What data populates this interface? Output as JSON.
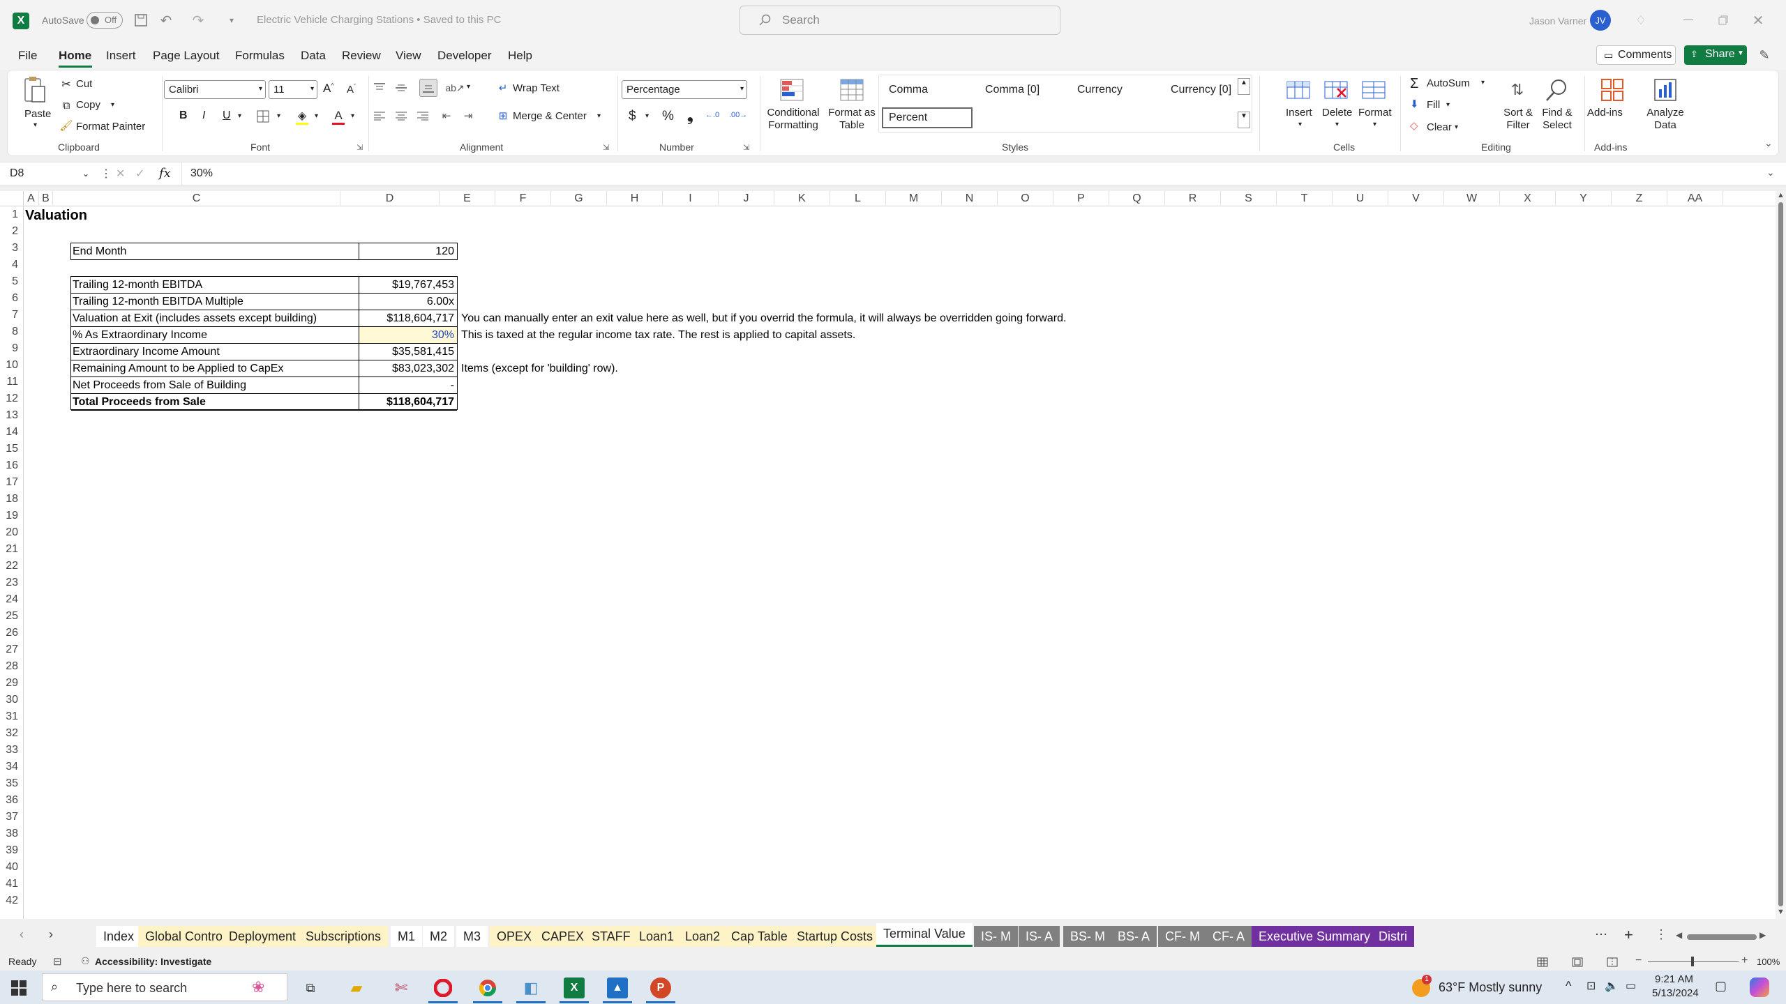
{
  "app": {
    "autosave_label": "AutoSave",
    "autosave_state": "Off",
    "doc_title": "Electric Vehicle Charging Stations • Saved to this PC",
    "search_placeholder": "Search",
    "user_name": "Jason Varner",
    "user_initials": "JV"
  },
  "menu": [
    "File",
    "Home",
    "Insert",
    "Page Layout",
    "Formulas",
    "Data",
    "Review",
    "View",
    "Developer",
    "Help"
  ],
  "menu_active": "Home",
  "comments_label": "Comments",
  "share_label": "Share",
  "ribbon": {
    "clipboard": {
      "paste": "Paste",
      "cut": "Cut",
      "copy": "Copy",
      "format_painter": "Format Painter",
      "label": "Clipboard"
    },
    "font": {
      "name": "Calibri",
      "size": "11",
      "label": "Font",
      "bold": "B",
      "italic": "I",
      "underline": "U"
    },
    "alignment": {
      "wrap": "Wrap Text",
      "merge": "Merge & Center",
      "label": "Alignment"
    },
    "number": {
      "format": "Percentage",
      "label": "Number",
      "currency_symbol": "$",
      "percent_symbol": "%",
      "comma_symbol": "❟"
    },
    "cond_fmt": "Conditional Formatting",
    "fmt_table": "Format as Table",
    "styles": {
      "label": "Styles",
      "items": [
        "Comma",
        "Comma [0]",
        "Currency",
        "Currency [0]",
        "Percent"
      ]
    },
    "cells": {
      "insert": "Insert",
      "delete": "Delete",
      "format": "Format",
      "label": "Cells"
    },
    "editing": {
      "autosum": "AutoSum",
      "fill": "Fill",
      "clear": "Clear",
      "sort": "Sort & Filter",
      "find": "Find & Select",
      "label": "Editing"
    },
    "addins": {
      "addins": "Add-ins",
      "analyze": "Analyze Data",
      "label": "Add-ins"
    }
  },
  "formula_bar": {
    "name_box": "D8",
    "value": "30%",
    "fx": "fx"
  },
  "columns": [
    "A",
    "B",
    "C",
    "D",
    "E",
    "F",
    "G",
    "H",
    "I",
    "J",
    "K",
    "L",
    "M",
    "N",
    "O",
    "P",
    "Q",
    "R",
    "S",
    "T",
    "U",
    "V",
    "W",
    "X",
    "Y",
    "Z",
    "AA"
  ],
  "rows": [
    "1",
    "2",
    "3",
    "4",
    "5",
    "6",
    "7",
    "8",
    "9",
    "10",
    "11",
    "12",
    "13",
    "14",
    "15",
    "16",
    "17",
    "18",
    "19",
    "20",
    "21",
    "22",
    "23",
    "24",
    "25",
    "26",
    "27",
    "28",
    "29",
    "30",
    "31",
    "32",
    "33",
    "34",
    "35",
    "36",
    "37",
    "38",
    "39",
    "40",
    "41",
    "42"
  ],
  "sheet": {
    "title": "Valuation",
    "end_month_label": "End Month",
    "end_month_value": "120",
    "rows": [
      {
        "label": "Trailing 12-month EBITDA",
        "value": "$19,767,453"
      },
      {
        "label": "Trailing 12-month EBITDA Multiple",
        "value": "6.00x"
      },
      {
        "label": "Valuation at Exit (includes assets except building)",
        "value": "$118,604,717",
        "note": "You can manually enter an exit value here as well, but if you overrid the formula, it will always be overridden going forward."
      },
      {
        "label": "% As Extraordinary Income",
        "value": "30%",
        "note": "This is taxed at the regular income tax rate. The rest is applied to capital assets."
      },
      {
        "label": "Extraordinary Income Amount",
        "value": "$35,581,415"
      },
      {
        "label": "Remaining Amount to be Applied to CapEx",
        "value": "$83,023,302",
        "note": "Items (except for 'building' row)."
      },
      {
        "label": "Net Proceeds from Sale of Building",
        "value": "-"
      },
      {
        "label": "Total Proceeds from Sale",
        "value": "$118,604,717"
      }
    ]
  },
  "tabs": [
    {
      "name": "Index",
      "color": "#ffffff",
      "text": "#242424"
    },
    {
      "name": "Global Control",
      "color": "#fef3c7",
      "text": "#242424"
    },
    {
      "name": "Deployment",
      "color": "#fef3c7",
      "text": "#242424"
    },
    {
      "name": "Subscriptions",
      "color": "#fef3c7",
      "text": "#242424"
    },
    {
      "name": "M1",
      "color": "#ffffff",
      "text": "#242424"
    },
    {
      "name": "M2",
      "color": "#ffffff",
      "text": "#242424"
    },
    {
      "name": "M3",
      "color": "#ffffff",
      "text": "#242424"
    },
    {
      "name": "OPEX",
      "color": "#fef3c7",
      "text": "#242424"
    },
    {
      "name": "CAPEX",
      "color": "#fef3c7",
      "text": "#242424"
    },
    {
      "name": "STAFF",
      "color": "#fef3c7",
      "text": "#242424"
    },
    {
      "name": "Loan1",
      "color": "#fef3c7",
      "text": "#242424"
    },
    {
      "name": "Loan2",
      "color": "#fef3c7",
      "text": "#242424"
    },
    {
      "name": "Cap Table",
      "color": "#fef3c7",
      "text": "#242424"
    },
    {
      "name": "Startup Costs",
      "color": "#fef3c7",
      "text": "#242424"
    },
    {
      "name": "Terminal Value",
      "color": "#ffffff",
      "text": "#242424",
      "active": true
    },
    {
      "name": "IS- M",
      "color": "#808080",
      "text": "#ffffff"
    },
    {
      "name": "IS- A",
      "color": "#808080",
      "text": "#ffffff"
    },
    {
      "name": "BS- M",
      "color": "#808080",
      "text": "#ffffff"
    },
    {
      "name": "BS- A",
      "color": "#808080",
      "text": "#ffffff"
    },
    {
      "name": "CF- M",
      "color": "#808080",
      "text": "#ffffff"
    },
    {
      "name": "CF- A",
      "color": "#808080",
      "text": "#ffffff"
    },
    {
      "name": "Executive Summary",
      "color": "#7030a0",
      "text": "#ffffff"
    },
    {
      "name": "Distri",
      "color": "#7030a0",
      "text": "#ffffff"
    }
  ],
  "status": {
    "ready": "Ready",
    "accessibility": "Accessibility: Investigate",
    "zoom": "100%"
  },
  "taskbar": {
    "search_placeholder": "Type here to search",
    "weather": "63°F  Mostly sunny",
    "time": "9:21 AM",
    "date": "5/13/2024",
    "weather_badge": "1"
  },
  "colors": {
    "accent": "#107c41",
    "selected_cell": "#fff9d6",
    "value_blue": "#1f3fbf"
  }
}
